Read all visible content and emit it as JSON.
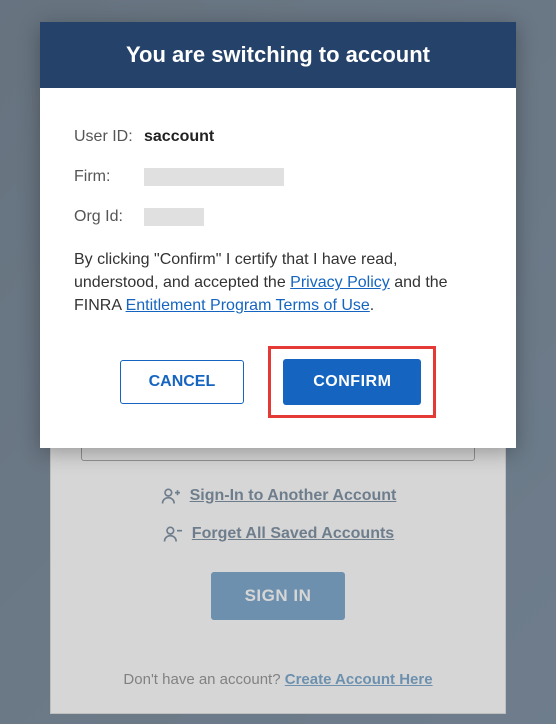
{
  "modal": {
    "title": "You are switching to account",
    "userIdLabel": "User ID:",
    "userIdValue": "saccount",
    "firmLabel": "Firm:",
    "orgIdLabel": "Org Id:",
    "consentPart1": "By clicking \"Confirm\" I certify that I have read, understood, and accepted the ",
    "privacyPolicy": "Privacy Policy",
    "consentPart2": " and the FINRA ",
    "termsOfUse": "Entitlement Program Terms of Use",
    "consentPart3": ".",
    "cancelLabel": "CANCEL",
    "confirmLabel": "CONFIRM"
  },
  "background": {
    "signInAnother": "Sign-In to Another Account",
    "forgetAll": "Forget All Saved Accounts",
    "signInButton": "SIGN IN",
    "noAccountText": "Don't have an account?  ",
    "createAccountLink": "Create Account Here"
  }
}
